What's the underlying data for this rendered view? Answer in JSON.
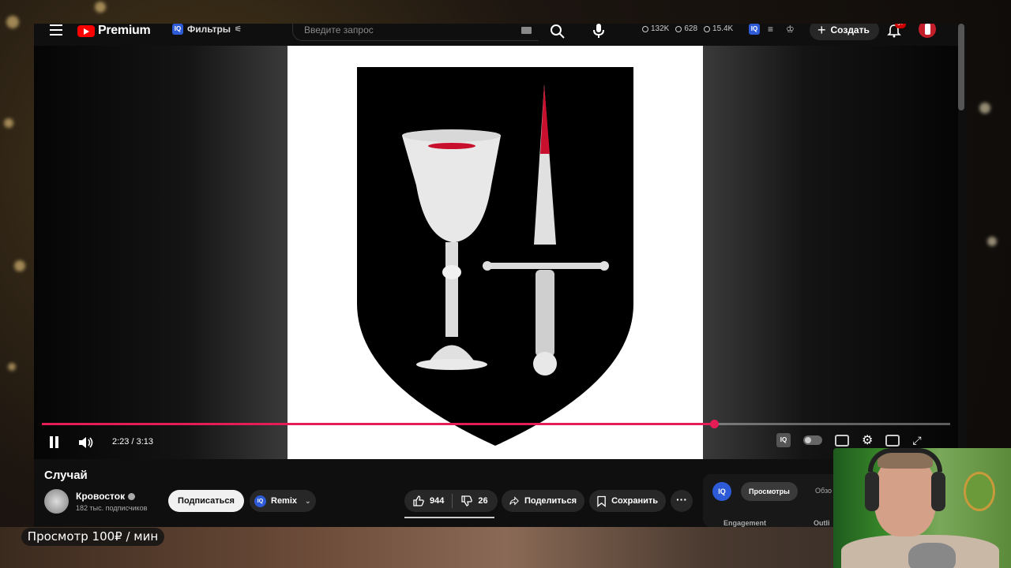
{
  "masthead": {
    "logo_text": "Premium",
    "filters_label": "Фильтры",
    "search_placeholder": "Введите запрос",
    "stats": {
      "views": "132K",
      "online": "628",
      "watched": "15.4K"
    },
    "create_label": "Создать",
    "notification_count": "9+"
  },
  "player": {
    "time_current": "2:23",
    "time_total": "3:13",
    "time_display": "2:23 / 3:13",
    "progress": 0.74
  },
  "video": {
    "title": "Случай",
    "channel_name": "Кровосток",
    "subscribers": "182 тыс. подписчиков",
    "subscribe_label": "Подписаться",
    "remix_label": "Remix",
    "likes": "944",
    "dislikes": "26",
    "share_label": "Поделиться",
    "save_label": "Сохранить"
  },
  "side_panel": {
    "tab_active": "Просмотры",
    "tab_next": "Обзо",
    "engagement_label": "Engagement",
    "outliers_label": "Outli"
  },
  "overlay": {
    "promo_text": "Просмотр 100₽ / мин"
  },
  "colors": {
    "accent_red": "#ff0000",
    "progress": "#e51d57",
    "iq_blue": "#2d5bd7",
    "background": "#0f0f0f"
  }
}
